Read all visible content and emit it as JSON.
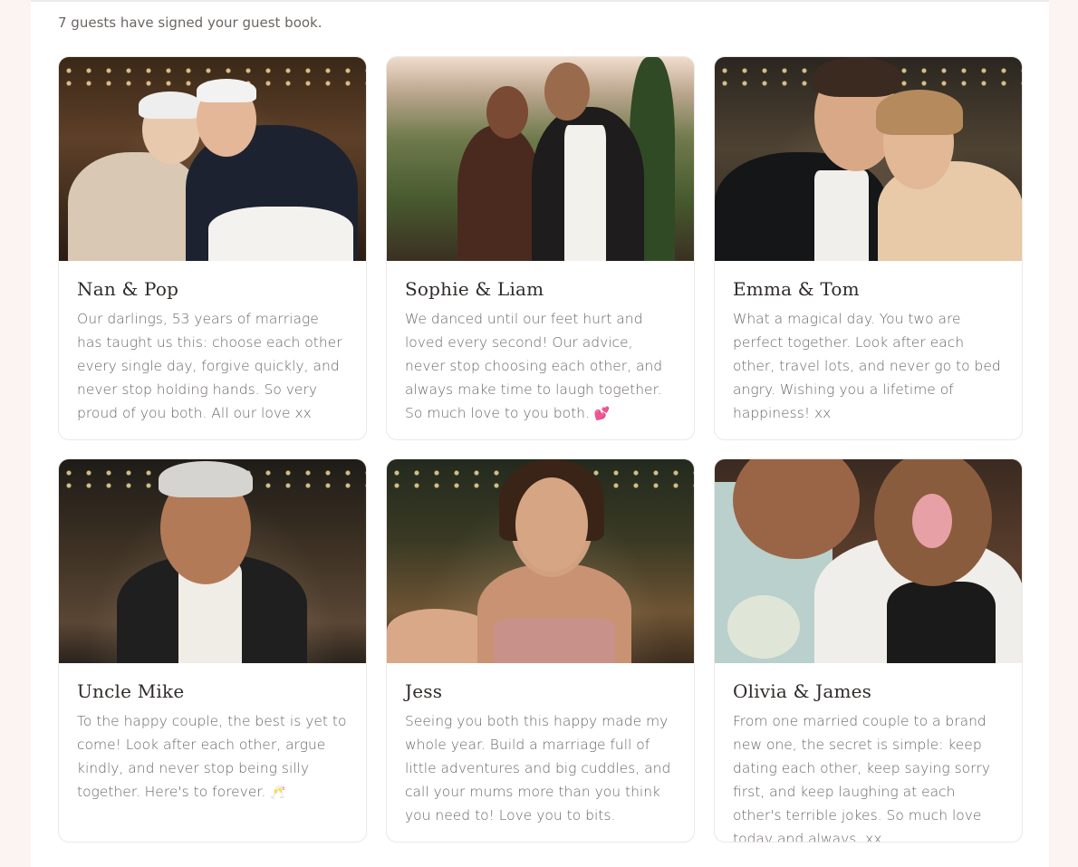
{
  "intro": "7 guests have signed your guest book.",
  "entries": [
    {
      "name": "Nan & Pop",
      "message": "Our darlings, 53 years of marriage has taught us this: choose each other every single day, forgive quickly, and never stop holding hands. So very proud of you both. All our love xx",
      "emoji": ""
    },
    {
      "name": "Sophie & Liam",
      "message": "We danced until our feet hurt and loved every second! Our advice, never stop choosing each other, and always make time to laugh together. So much love to you both.",
      "emoji": "💕"
    },
    {
      "name": "Emma & Tom",
      "message": "What a magical day. You two are perfect together. Look after each other, travel lots, and never go to bed angry. Wishing you a lifetime of happiness! xx",
      "emoji": ""
    },
    {
      "name": "Uncle Mike",
      "message": "To the happy couple, the best is yet to come! Look after each other, argue kindly, and never stop being silly together. Here's to forever.",
      "emoji": "🥂"
    },
    {
      "name": "Jess",
      "message": "Seeing you both this happy made my whole year. Build a marriage full of little adventures and big cuddles, and call your mums more than you think you need to! Love you to bits.",
      "emoji": ""
    },
    {
      "name": "Olivia & James",
      "message": "From one married couple to a brand new one, the secret is simple: keep dating each other, keep saying sorry first, and keep laughing at each other's terrible jokes. So much love today and always. xx",
      "emoji": ""
    }
  ]
}
